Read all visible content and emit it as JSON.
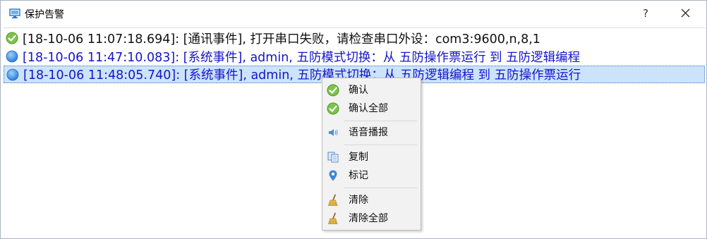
{
  "window": {
    "title": "保护告警",
    "help_label": "?",
    "close_icon": "close-icon"
  },
  "log": {
    "rows": [
      {
        "icon": "check-circle-icon",
        "text": "[18-10-06 11:07:18.694]: [通讯事件], 打开串口失败，请检查串口外设：com3:9600,n,8,1",
        "color": "#111111"
      },
      {
        "icon": "blue-dot-icon",
        "text": "[18-10-06 11:47:10.083]: [系统事件], admin, 五防模式切换：从 五防操作票运行 到 五防逻辑编程",
        "color": "#1515c8"
      },
      {
        "icon": "blue-dot-icon",
        "text": "[18-10-06 11:48:05.740]: [系统事件], admin, 五防模式切换：从 五防逻辑编程 到 五防操作票运行",
        "color": "#1515c8",
        "selected": true
      }
    ]
  },
  "context_menu": {
    "items": [
      {
        "label": "确认",
        "icon": "check-circle-icon"
      },
      {
        "label": "确认全部",
        "icon": "check-circle-icon"
      },
      {
        "label": "语音播报",
        "icon": "speaker-icon"
      },
      {
        "label": "复制",
        "icon": "copy-icon"
      },
      {
        "label": "标记",
        "icon": "location-pin-icon"
      },
      {
        "label": "清除",
        "icon": "broom-icon"
      },
      {
        "label": "清除全部",
        "icon": "broom-icon"
      }
    ]
  },
  "colors": {
    "accent": "#1515c8",
    "selection": "#cce4fb",
    "check_green": "#7cc44a",
    "dot_blue": "#3a8fe0"
  }
}
